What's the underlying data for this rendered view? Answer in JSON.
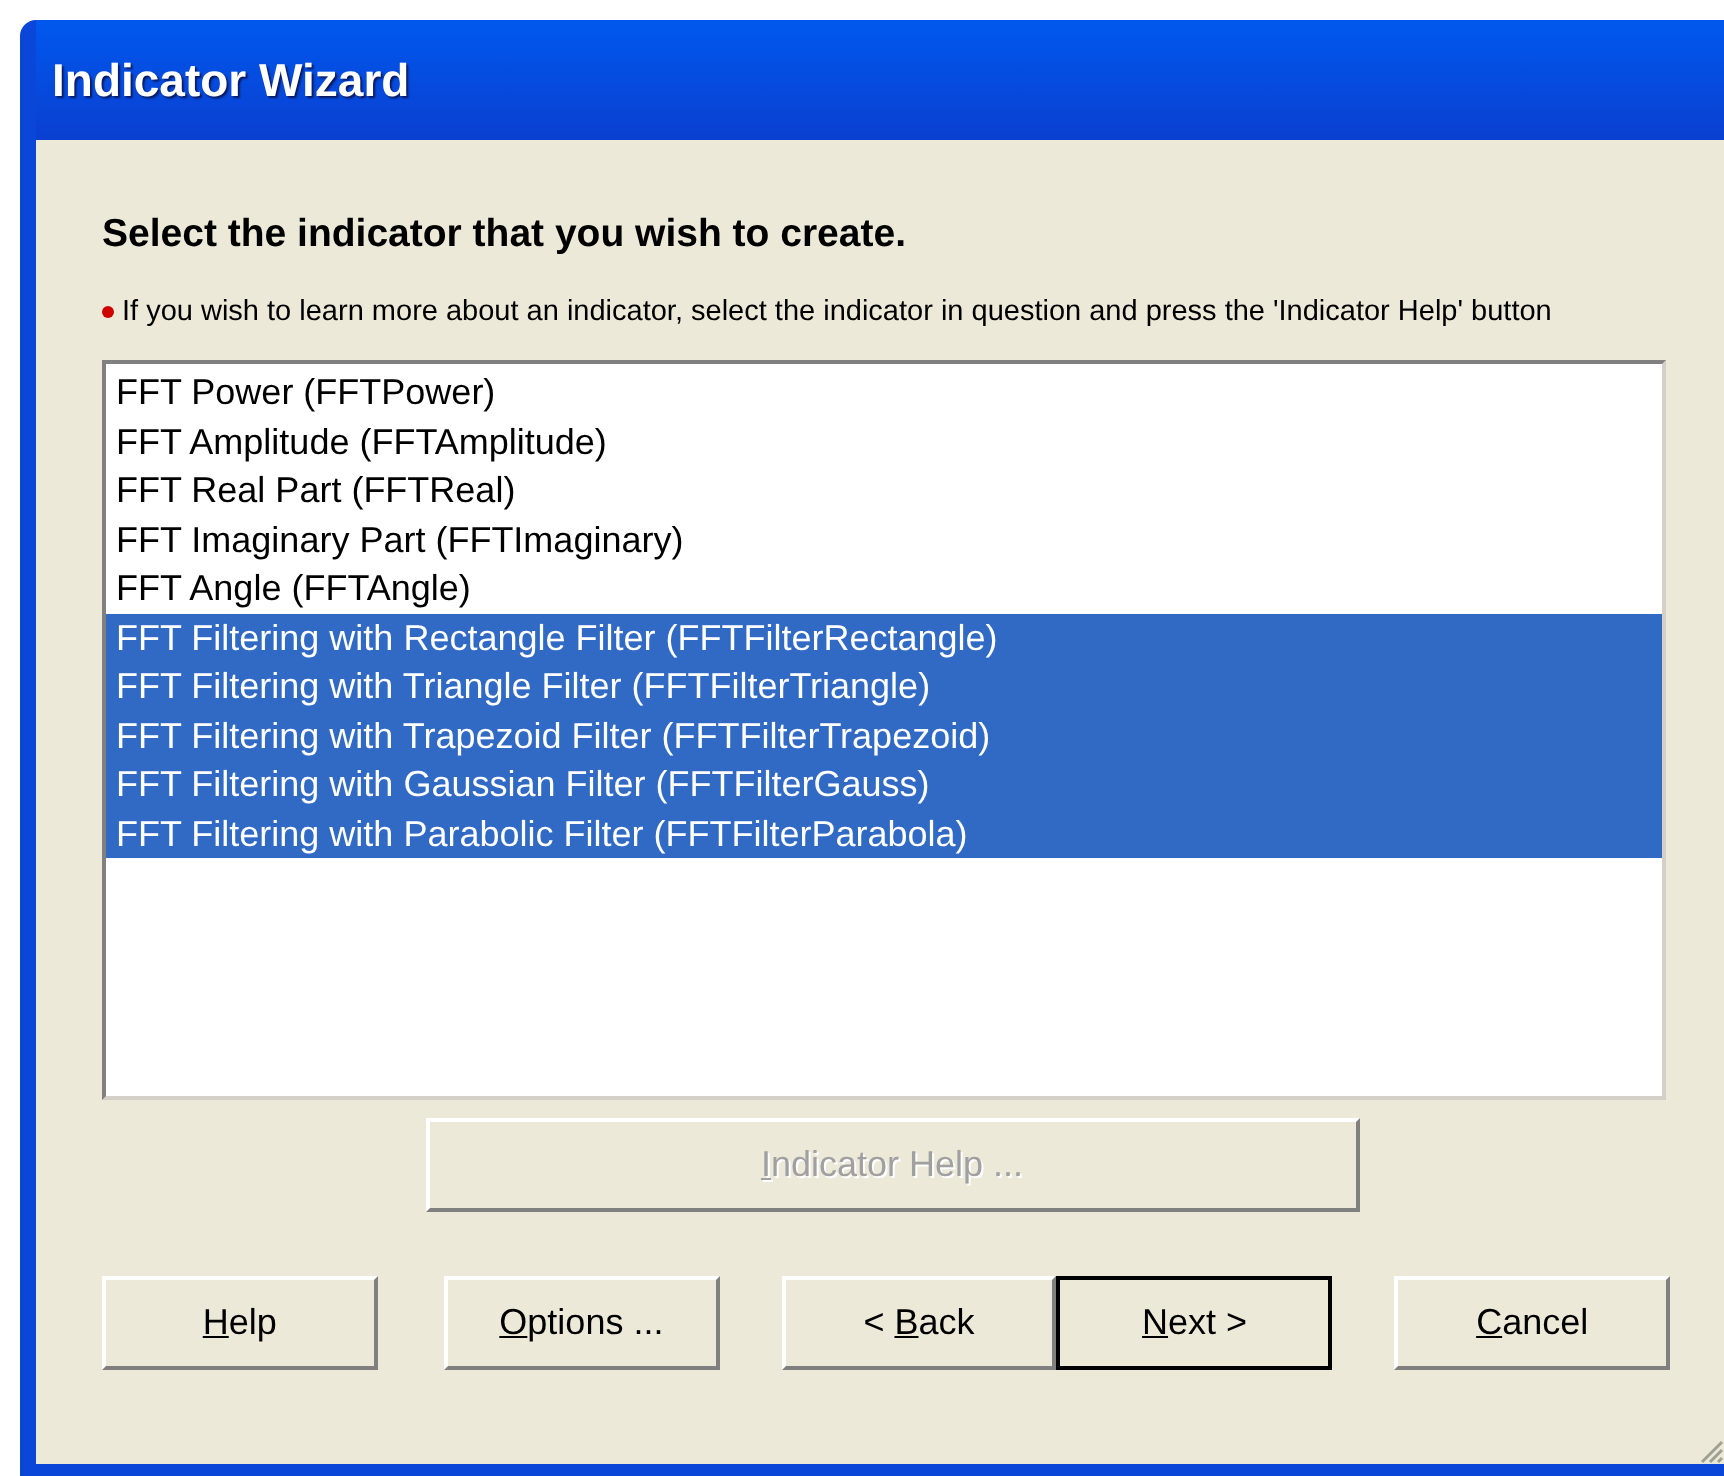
{
  "window": {
    "title": "Indicator Wizard"
  },
  "heading": "Select the indicator that you wish to create.",
  "note": "If you wish to learn more about an indicator, select the indicator in question and press the 'Indicator Help' button",
  "indicators": [
    {
      "label": "FFT Power (FFTPower)",
      "selected": false
    },
    {
      "label": "FFT Amplitude (FFTAmplitude)",
      "selected": false
    },
    {
      "label": "FFT Real Part (FFTReal)",
      "selected": false
    },
    {
      "label": "FFT Imaginary Part (FFTImaginary)",
      "selected": false
    },
    {
      "label": "FFT Angle (FFTAngle)",
      "selected": false
    },
    {
      "label": "FFT Filtering with Rectangle Filter (FFTFilterRectangle)",
      "selected": true
    },
    {
      "label": "FFT Filtering with Triangle Filter (FFTFilterTriangle)",
      "selected": true
    },
    {
      "label": "FFT Filtering with Trapezoid Filter (FFTFilterTrapezoid)",
      "selected": true
    },
    {
      "label": "FFT Filtering with Gaussian Filter (FFTFilterGauss)",
      "selected": true
    },
    {
      "label": "FFT Filtering with Parabolic Filter (FFTFilterParabola)",
      "selected": true
    }
  ],
  "indicator_help_button": {
    "mnemonic": "I",
    "after": "ndicator Help ...",
    "disabled": true
  },
  "buttons": [
    {
      "mnemonic": "H",
      "after": "elp",
      "default": false
    },
    {
      "mnemonic": "O",
      "after": "ptions ...",
      "default": false
    },
    {
      "before": "< ",
      "mnemonic": "B",
      "after": "ack",
      "default": false
    },
    {
      "mnemonic": "N",
      "after": "ext >",
      "default": true
    },
    {
      "mnemonic": "C",
      "after": "ancel",
      "default": false
    }
  ]
}
